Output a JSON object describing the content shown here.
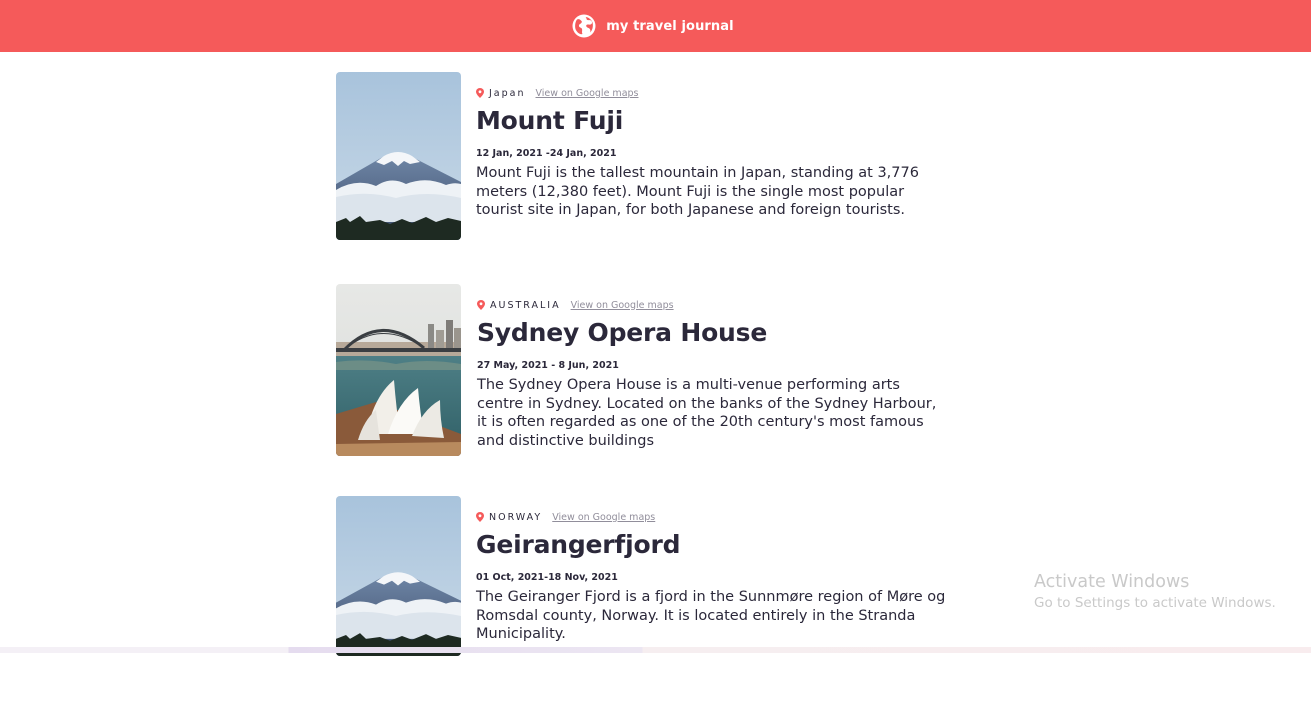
{
  "navbar": {
    "title": "my travel journal",
    "icon": "globe-icon",
    "color": "#f55a5a"
  },
  "entries": [
    {
      "country": "Japan",
      "maps_link": "View on Google maps",
      "title": "Mount Fuji",
      "dates": "12 Jan, 2021 -24 Jan, 2021",
      "description": "Mount Fuji is the tallest mountain in Japan, standing at 3,776 meters (12,380 feet). Mount Fuji is the single most popular tourist site in Japan, for both Japanese and foreign tourists.",
      "image": "mount-fuji-photo"
    },
    {
      "country": "AUSTRALIA",
      "maps_link": "View on Google maps",
      "title": "Sydney Opera House",
      "dates": "27 May, 2021 - 8 Jun, 2021",
      "description": "The Sydney Opera House is a multi-venue performing arts centre in Sydney. Located on the banks of the Sydney Harbour, it is often regarded as one of the 20th century's most famous and distinctive buildings",
      "image": "sydney-opera-house-photo"
    },
    {
      "country": "NORWAY",
      "maps_link": "View on Google maps",
      "title": "Geirangerfjord",
      "dates": "01 Oct, 2021-18 Nov, 2021",
      "description": "The Geiranger Fjord is a fjord in the Sunnmøre region of Møre og Romsdal county, Norway. It is located entirely in the Stranda Municipality.",
      "image": "mount-fuji-photo"
    }
  ],
  "watermark": {
    "title": "Activate Windows",
    "subtitle": "Go to Settings to activate Windows."
  }
}
